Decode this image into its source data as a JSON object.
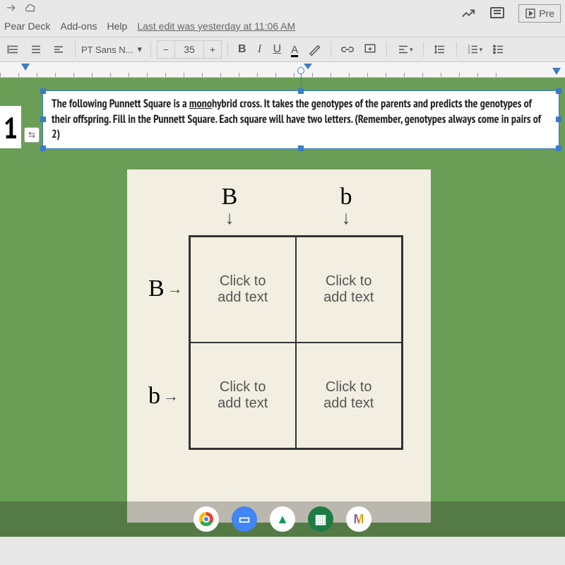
{
  "menubar": {
    "items": [
      "Pear Deck",
      "Add-ons",
      "Help"
    ],
    "edit_note": "Last edit was yesterday at 11:06 AM",
    "present_label": "Pre"
  },
  "toolbar": {
    "font_name": "PT Sans N...",
    "font_size": "35",
    "bold": "B",
    "italic": "I",
    "underline": "U",
    "text_color": "A"
  },
  "slide": {
    "number": "1",
    "instruction": "The following Punnett Square is a monohybrid cross. It takes the genotypes of the parents and predicts the genotypes of their offspring. Fill in the Punnett Square. Each square will have two letters. (Remember, genotypes always come in pairs of 2)",
    "mono_word": "mono"
  },
  "punnett": {
    "col1": "B",
    "col2": "b",
    "row1": "B",
    "row2": "b",
    "placeholder_l1": "Click to",
    "placeholder_l2": "add text"
  },
  "taskbar": {
    "gmail_letter": "M"
  }
}
